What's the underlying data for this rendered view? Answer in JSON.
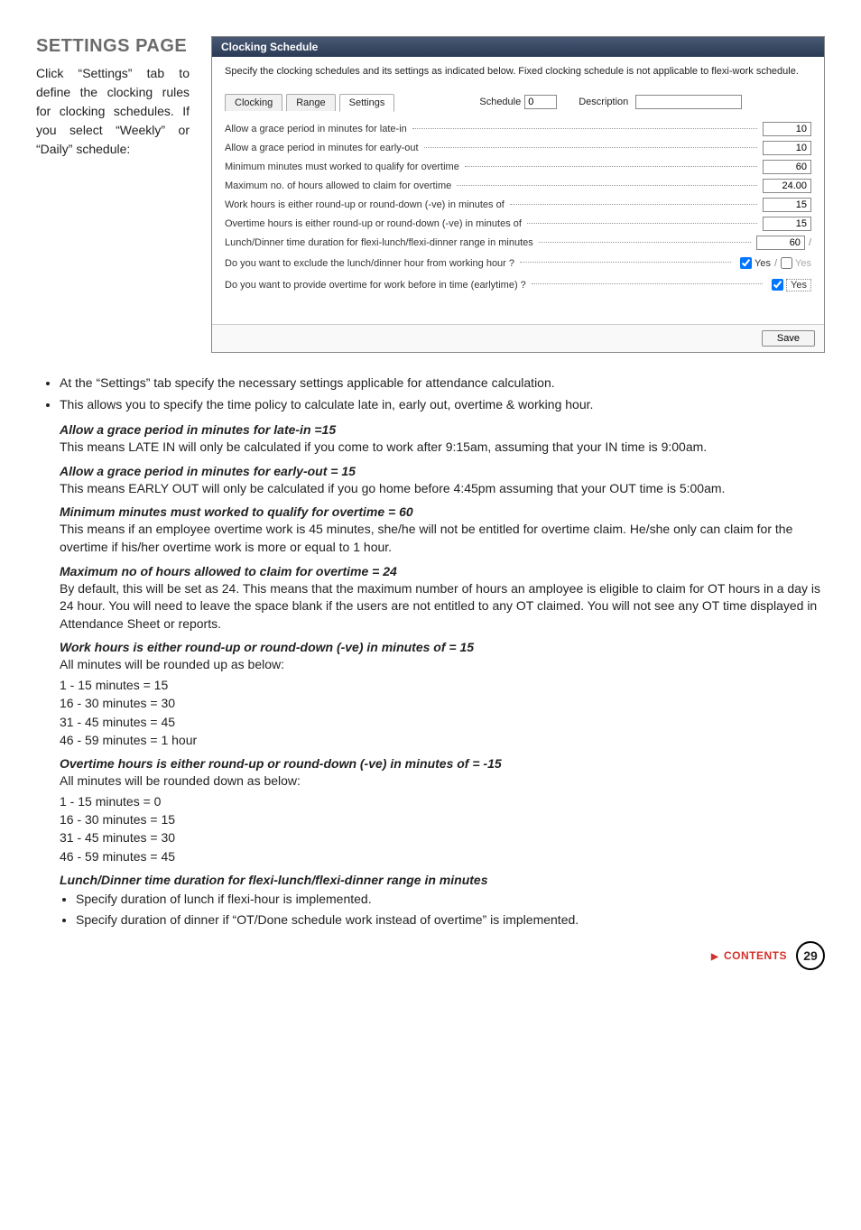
{
  "leftColumn": {
    "title": "SETTINGS PAGE",
    "intro": "Click “Settings” tab to define the clocking rules for clocking schedules. If you select “Weekly” or “Daily” schedule:"
  },
  "screenshot": {
    "titlebar": "Clocking Schedule",
    "specify": "Specify the clocking schedules and its settings as indicated below. Fixed clocking schedule is not applicable to flexi-work schedule.",
    "tabs": {
      "clocking": "Clocking",
      "range": "Range",
      "settings": "Settings"
    },
    "scheduleLabel": "Schedule",
    "scheduleValue": "0",
    "descriptionLabel": "Description",
    "lines": {
      "lateIn": {
        "label": "Allow a grace period in minutes for late-in",
        "value": "10"
      },
      "earlyOut": {
        "label": "Allow a grace period in minutes for early-out",
        "value": "10"
      },
      "minOT": {
        "label": "Minimum minutes must worked to qualify for overtime",
        "value": "60"
      },
      "maxOT": {
        "label": "Maximum no. of hours allowed to claim for overtime",
        "value": "24.00"
      },
      "roundWork": {
        "label": "Work hours is either round-up or round-down (-ve) in minutes of",
        "value": "15"
      },
      "roundOT": {
        "label": "Overtime hours is either round-up or round-down (-ve) in minutes of",
        "value": "15"
      },
      "lunchDur": {
        "label": "Lunch/Dinner time duration for flexi-lunch/flexi-dinner range in minutes",
        "value": "60"
      },
      "excludeLunch": {
        "label": "Do you want to exclude the lunch/dinner hour from working hour ?",
        "yes": "Yes",
        "yes2": "Yes"
      },
      "earlyOT": {
        "label": "Do you want to provide overtime for work before in time (earlytime) ?",
        "yes": "Yes"
      }
    },
    "saveLabel": "Save"
  },
  "bullets": {
    "b1": "At the “Settings” tab specify the necessary settings applicable for attendance calculation.",
    "b2": "This allows you to specify the time policy to calculate late in, early out, overtime & working hour."
  },
  "sections": {
    "lateIn": {
      "heading": "Allow a grace period in minutes for late-in =15",
      "body": "This means LATE IN will only be calculated if you come to work after 9:15am, assuming that your IN time is 9:00am."
    },
    "earlyOut": {
      "heading": "Allow a grace period in minutes for early-out = 15",
      "body": "This means EARLY OUT will only be calculated if you go home before 4:45pm assuming that your OUT time is 5:00am."
    },
    "minOT": {
      "heading": "Minimum minutes must worked to qualify for overtime = 60",
      "body": "This means if an employee overtime work is 45 minutes, she/he will not be entitled for overtime claim. He/she only can claim for the overtime if his/her overtime work is more or equal to 1 hour."
    },
    "maxOT": {
      "heading": "Maximum no of hours allowed to claim for overtime = 24",
      "body": "By default, this will be set as 24. This means that the maximum number of hours an amployee is eligible to claim for OT hours in a day is 24 hour. You will need to leave the space blank if the users are not entitled to any OT claimed. You will not see any OT time displayed in Attendance Sheet or reports."
    },
    "roundWork": {
      "heading": "Work hours is either round-up or round-down (-ve) in minutes of = 15",
      "body": "All minutes will be rounded up as below:",
      "l1": "1 - 15 minutes = 15",
      "l2": "16 - 30 minutes = 30",
      "l3": "31 - 45 minutes = 45",
      "l4": "46 - 59 minutes = 1 hour"
    },
    "roundOT": {
      "heading": "Overtime hours is either round-up or round-down (-ve) in minutes of = -15",
      "body": "All minutes will be rounded down as below:",
      "l1": "1 - 15 minutes = 0",
      "l2": "16 - 30 minutes = 15",
      "l3": "31 - 45 minutes = 30",
      "l4": "46 - 59 minutes = 45"
    },
    "lunchDinner": {
      "heading": "Lunch/Dinner time duration for flexi-lunch/flexi-dinner range in minutes",
      "b1": "Specify duration of lunch if flexi-hour is implemented.",
      "b2": "Specify duration of dinner if “OT/Done schedule work instead of overtime” is implemented."
    }
  },
  "footer": {
    "contents": "CONTENTS",
    "page": "29"
  }
}
